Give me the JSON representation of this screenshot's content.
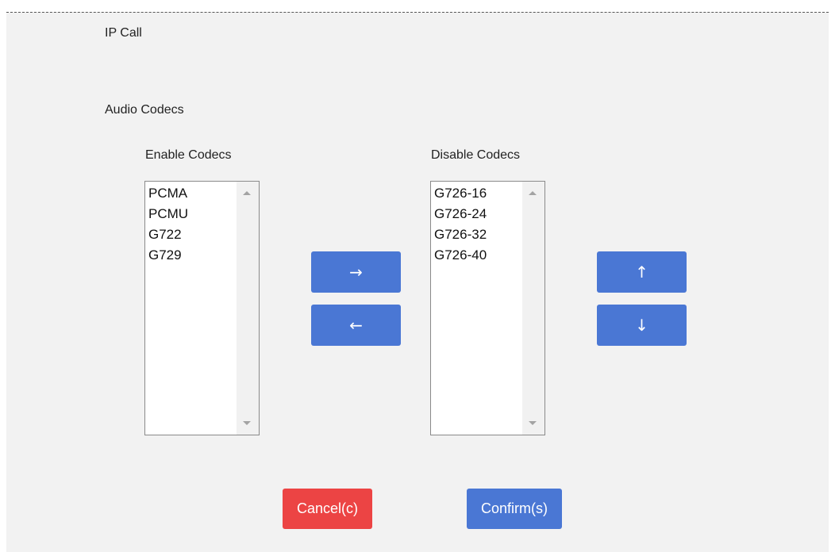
{
  "section": {
    "title": "IP Call"
  },
  "audio": {
    "title": "Audio Codecs"
  },
  "enable": {
    "label": "Enable Codecs",
    "items": [
      "PCMA",
      "PCMU",
      "G722",
      "G729"
    ]
  },
  "disable": {
    "label": "Disable Codecs",
    "items": [
      "G726-16",
      "G726-24",
      "G726-32",
      "G726-40"
    ]
  },
  "buttons": {
    "move_right": "→",
    "move_left": "←",
    "move_up": "↑",
    "move_down": "↓",
    "cancel": "Cancel(c)",
    "confirm": "Confirm(s)"
  },
  "colors": {
    "primary": "#4a77d4",
    "danger": "#ec4444",
    "panel_bg": "#f2f2f2"
  },
  "icons": {
    "move_right": "arrow-right-icon",
    "move_left": "arrow-left-icon",
    "move_up": "arrow-up-icon",
    "move_down": "arrow-down-icon"
  }
}
